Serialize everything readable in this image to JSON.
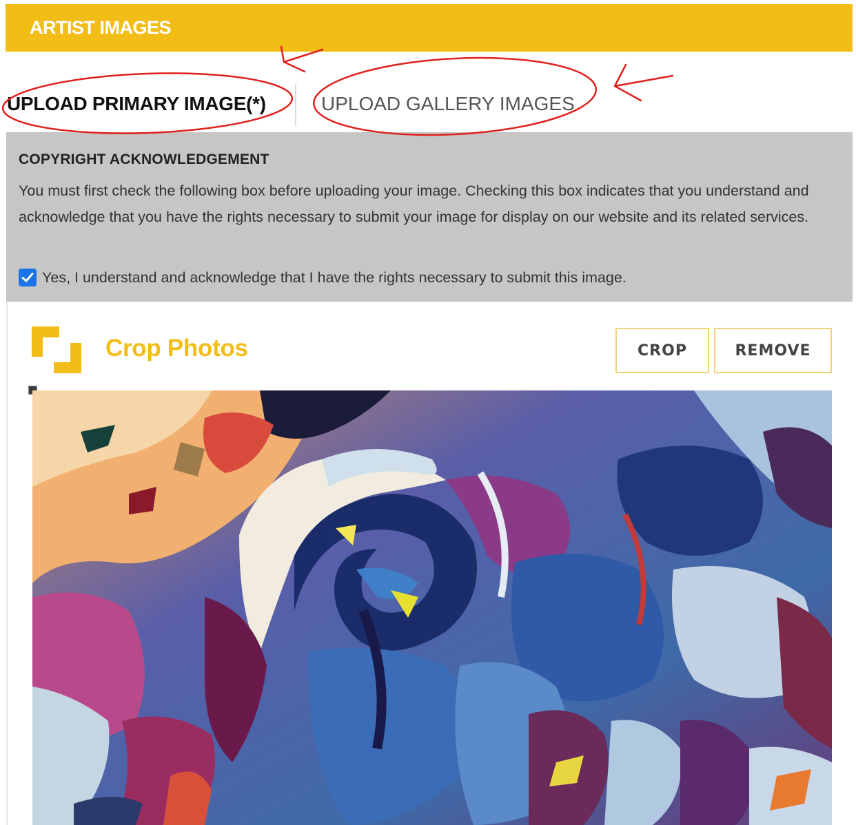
{
  "header": {
    "title": "ARTIST IMAGES",
    "color": "#f3bd18"
  },
  "tabs": [
    {
      "label": "UPLOAD PRIMARY IMAGE(*)",
      "active": true
    },
    {
      "label": "UPLOAD GALLERY IMAGES",
      "active": false
    }
  ],
  "copyright": {
    "title": "COPYRIGHT ACKNOWLEDGEMENT",
    "body": "You must first check the following box before uploading your image. Checking this box indicates that you understand and acknowledge that you have the rights necessary to submit your image for display on our website and its related services.",
    "checkbox_label": "Yes, I understand and acknowledge that I have the rights necessary to submit this image.",
    "checked": true
  },
  "crop": {
    "title": "Crop Photos",
    "icon": "crop-icon",
    "crop_button": "CROP",
    "remove_button": "REMOVE"
  },
  "annotation_color": "#e0201c"
}
